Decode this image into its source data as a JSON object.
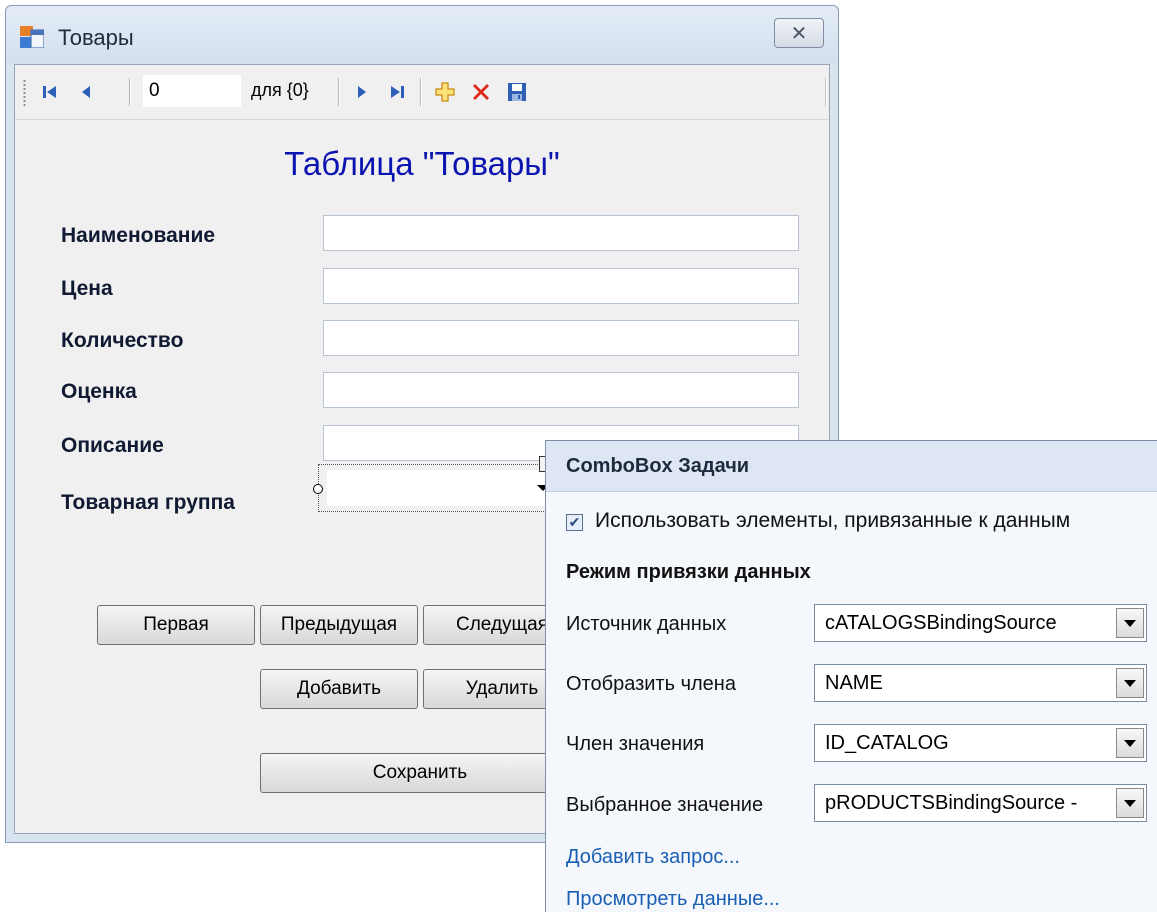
{
  "window": {
    "title": "Товары",
    "close_label": "✕"
  },
  "toolbar": {
    "position_value": "0",
    "count_label": "для {0}",
    "buttons": [
      "move-first",
      "move-previous",
      "move-next",
      "move-last",
      "add-new",
      "delete",
      "save"
    ]
  },
  "form": {
    "heading": "Таблица \"Товары\"",
    "fields": [
      {
        "label": "Наименование",
        "value": ""
      },
      {
        "label": "Цена",
        "value": ""
      },
      {
        "label": "Количество",
        "value": ""
      },
      {
        "label": "Оценка",
        "value": ""
      },
      {
        "label": "Описание",
        "value": ""
      }
    ],
    "group_label": "Товарная группа",
    "buttons": {
      "first": "Первая",
      "previous": "Предыдущая",
      "next": "Следущая",
      "add": "Добавить",
      "delete": "Удалить",
      "save": "Сохранить"
    }
  },
  "smart_panel": {
    "title": "ComboBox Задачи",
    "use_bound_items_label": "Использовать элементы, привязанные к данным",
    "use_bound_items_checked": true,
    "section": "Режим привязки данных",
    "properties": [
      {
        "label": "Источник данных",
        "value": "cATALOGSBindingSource"
      },
      {
        "label": "Отобразить члена",
        "value": "NAME"
      },
      {
        "label": "Член значения",
        "value": "ID_CATALOG"
      },
      {
        "label": "Выбранное значение",
        "value": "pRODUCTSBindingSource -"
      }
    ],
    "links": [
      "Добавить запрос...",
      "Просмотреть данные..."
    ]
  },
  "colors": {
    "heading": "#0b14b0",
    "link": "#1a5fb4",
    "panel_bg": "#f4f7fc"
  }
}
